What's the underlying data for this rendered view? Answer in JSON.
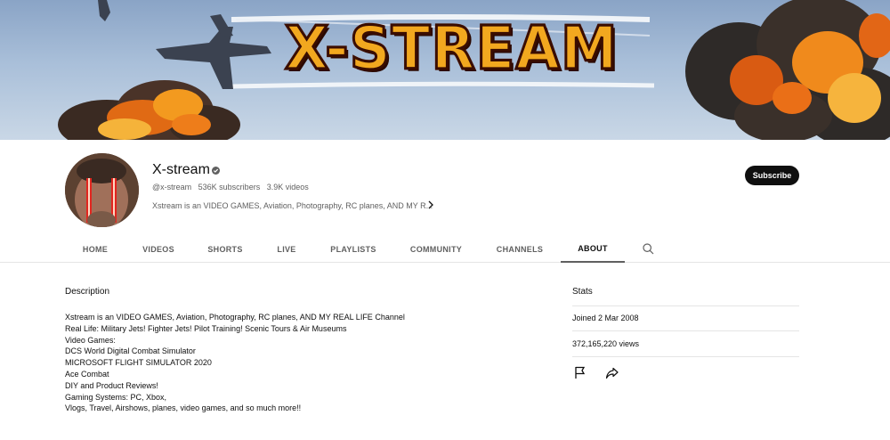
{
  "banner": {
    "title": "X-STREAM"
  },
  "channel": {
    "name": "X-stream",
    "handle": "@x-stream",
    "subscribers": "536K subscribers",
    "videos": "3.9K videos",
    "description_preview": "Xstream is an VIDEO GAMES, Aviation, Photography, RC planes, AND MY R...",
    "subscribe_label": "Subscribe"
  },
  "tabs": [
    {
      "label": "HOME"
    },
    {
      "label": "VIDEOS"
    },
    {
      "label": "SHORTS"
    },
    {
      "label": "LIVE"
    },
    {
      "label": "PLAYLISTS"
    },
    {
      "label": "COMMUNITY"
    },
    {
      "label": "CHANNELS"
    },
    {
      "label": "ABOUT"
    }
  ],
  "about": {
    "description_title": "Description",
    "description_lines": [
      "Xstream is an VIDEO GAMES, Aviation, Photography, RC planes, AND MY REAL LIFE Channel",
      "Real Life: Military Jets! Fighter Jets! Pilot Training! Scenic Tours & Air Museums",
      "Video Games:",
      "DCS World Digital Combat Simulator",
      "MICROSOFT FLIGHT SIMULATOR 2020",
      "Ace Combat",
      "DIY and Product Reviews!",
      "Gaming Systems: PC, Xbox,",
      "Vlogs, Travel, Airshows, planes, video games, and so much more!!"
    ],
    "stats_title": "Stats",
    "joined": "Joined 2 Mar 2008",
    "views": "372,165,220 views"
  },
  "icons": {
    "verified": "verified-check-icon",
    "chevron": "chevron-right-icon",
    "search": "search-icon",
    "flag": "flag-icon",
    "share": "share-icon"
  }
}
